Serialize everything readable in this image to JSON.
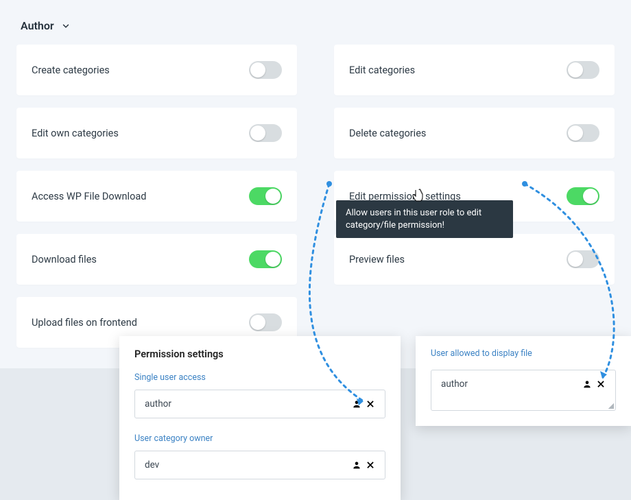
{
  "role_dropdown": {
    "selected": "Author"
  },
  "perms": {
    "create_categories": {
      "label": "Create categories",
      "on": false
    },
    "edit_categories": {
      "label": "Edit categories",
      "on": false
    },
    "edit_own_categories": {
      "label": "Edit own categories",
      "on": false
    },
    "delete_categories": {
      "label": "Delete categories",
      "on": false
    },
    "access_wpfd": {
      "label": "Access WP File Download",
      "on": true
    },
    "edit_permissions": {
      "label": "Edit permissions settings",
      "on": true
    },
    "download_files": {
      "label": "Download files",
      "on": true
    },
    "preview_files": {
      "label": "Preview files",
      "on": false
    },
    "upload_frontend": {
      "label": "Upload files on frontend",
      "on": false
    }
  },
  "tooltip": "Allow users in this user role to edit category/file permission!",
  "panel_a": {
    "title": "Permission settings",
    "fields": {
      "single_user_access": {
        "label": "Single user access",
        "value": "author"
      },
      "user_category_owner": {
        "label": "User category owner",
        "value": "dev"
      }
    }
  },
  "panel_b": {
    "title": "User allowed to display file",
    "field": {
      "value": "author"
    }
  }
}
